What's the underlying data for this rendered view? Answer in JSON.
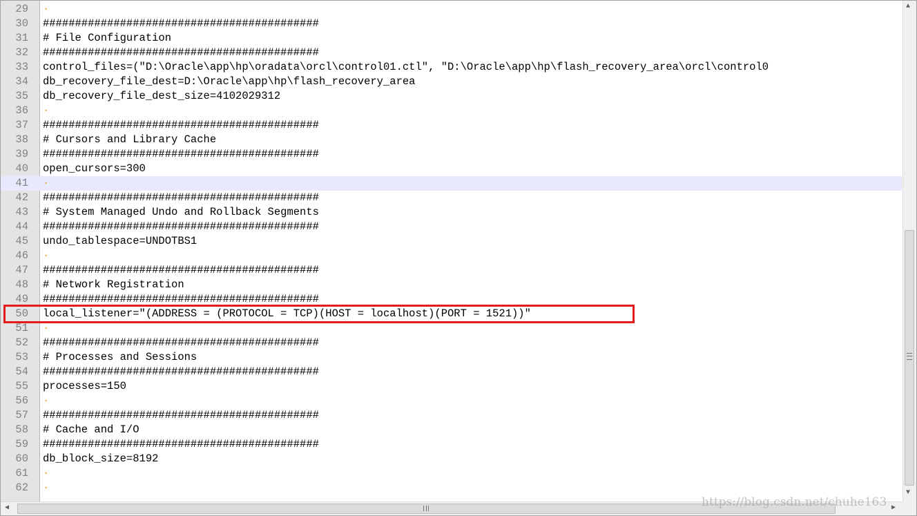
{
  "editor": {
    "lines": [
      {
        "num": "29",
        "text": ""
      },
      {
        "num": "30",
        "text": "###########################################"
      },
      {
        "num": "31",
        "text": "# File Configuration"
      },
      {
        "num": "32",
        "text": "###########################################"
      },
      {
        "num": "33",
        "text": "control_files=(\"D:\\Oracle\\app\\hp\\oradata\\orcl\\control01.ctl\", \"D:\\Oracle\\app\\hp\\flash_recovery_area\\orcl\\control0"
      },
      {
        "num": "34",
        "text": "db_recovery_file_dest=D:\\Oracle\\app\\hp\\flash_recovery_area"
      },
      {
        "num": "35",
        "text": "db_recovery_file_dest_size=4102029312"
      },
      {
        "num": "36",
        "text": ""
      },
      {
        "num": "37",
        "text": "###########################################"
      },
      {
        "num": "38",
        "text": "# Cursors and Library Cache"
      },
      {
        "num": "39",
        "text": "###########################################"
      },
      {
        "num": "40",
        "text": "open_cursors=300"
      },
      {
        "num": "41",
        "text": ""
      },
      {
        "num": "42",
        "text": "###########################################"
      },
      {
        "num": "43",
        "text": "# System Managed Undo and Rollback Segments"
      },
      {
        "num": "44",
        "text": "###########################################"
      },
      {
        "num": "45",
        "text": "undo_tablespace=UNDOTBS1"
      },
      {
        "num": "46",
        "text": ""
      },
      {
        "num": "47",
        "text": "###########################################"
      },
      {
        "num": "48",
        "text": "# Network Registration"
      },
      {
        "num": "49",
        "text": "###########################################"
      },
      {
        "num": "50",
        "text": "local_listener=\"(ADDRESS = (PROTOCOL = TCP)(HOST = localhost)(PORT = 1521))\""
      },
      {
        "num": "51",
        "text": ""
      },
      {
        "num": "52",
        "text": "###########################################"
      },
      {
        "num": "53",
        "text": "# Processes and Sessions"
      },
      {
        "num": "54",
        "text": "###########################################"
      },
      {
        "num": "55",
        "text": "processes=150"
      },
      {
        "num": "56",
        "text": ""
      },
      {
        "num": "57",
        "text": "###########################################"
      },
      {
        "num": "58",
        "text": "# Cache and I/O"
      },
      {
        "num": "59",
        "text": "###########################################"
      },
      {
        "num": "60",
        "text": "db_block_size=8192"
      },
      {
        "num": "61",
        "text": ""
      },
      {
        "num": "62",
        "text": ""
      }
    ],
    "current_line": "41",
    "highlighted_line": "50",
    "whitespace_marker": "·",
    "whitespace_color": "#f0a030",
    "highlight_color": "#e31b1b",
    "current_line_color": "#e8e8ff"
  },
  "scrollbars": {
    "up_arrow": "▲",
    "down_arrow": "▼",
    "left_arrow": "◀",
    "right_arrow": "▶"
  },
  "watermark": "https://blog.csdn.net/chuhe163"
}
